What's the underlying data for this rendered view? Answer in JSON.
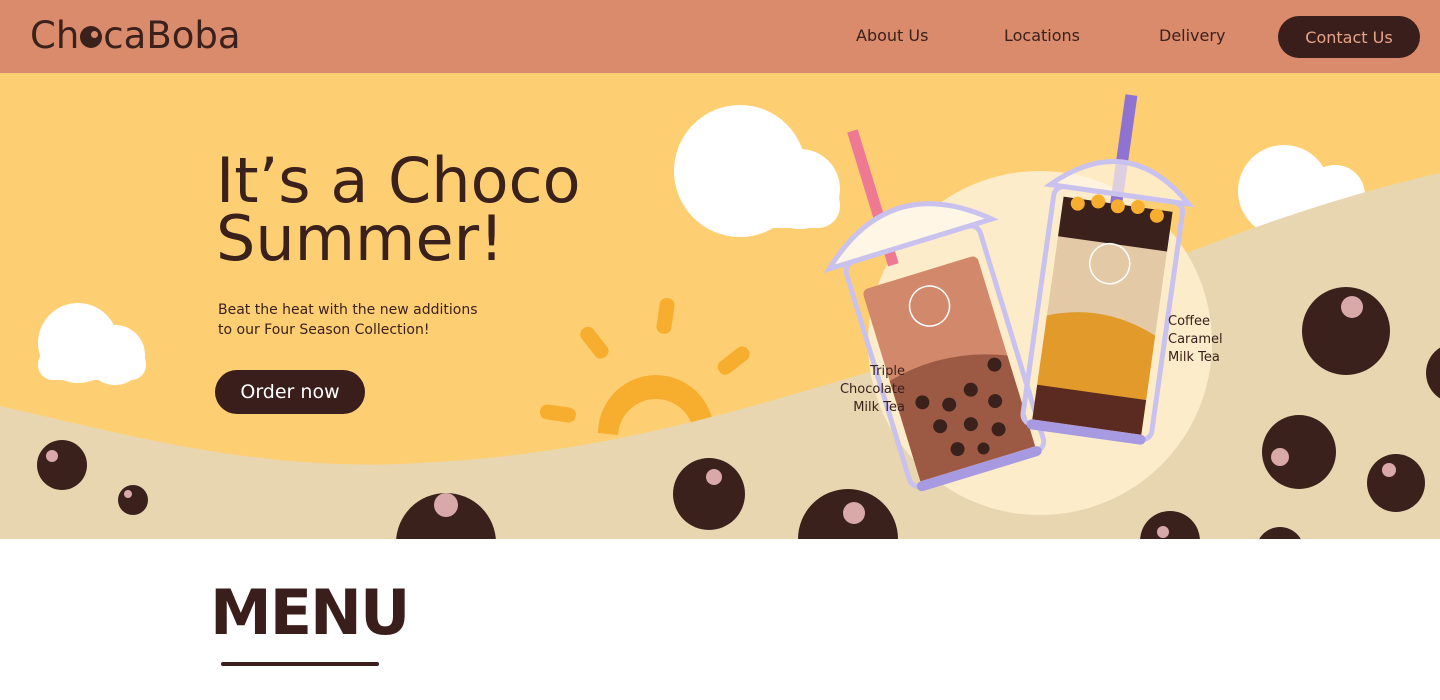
{
  "brand": {
    "logo_before": "Ch",
    "logo_after": "caBoba"
  },
  "nav": {
    "about": "About Us",
    "locations": "Locations",
    "delivery": "Delivery",
    "contact": "Contact Us"
  },
  "hero": {
    "title_line1": "It’s a Choco",
    "title_line2": "Summer!",
    "subtitle_line1": "Beat the heat with the new additions",
    "subtitle_line2": "to our Four Season Collection!",
    "cta": "Order now",
    "drink_left": [
      "Triple",
      "Chocolate",
      "Milk Tea"
    ],
    "drink_right": [
      "Coffee",
      "Caramel",
      "Milk Tea"
    ]
  },
  "menu": {
    "title": "MENU"
  },
  "colors": {
    "header": "#da8b6c",
    "sky": "#fecf72",
    "ground": "#e7d6b0",
    "dark": "#3a1e1b",
    "pearl_highlight": "#d9a8a8"
  }
}
